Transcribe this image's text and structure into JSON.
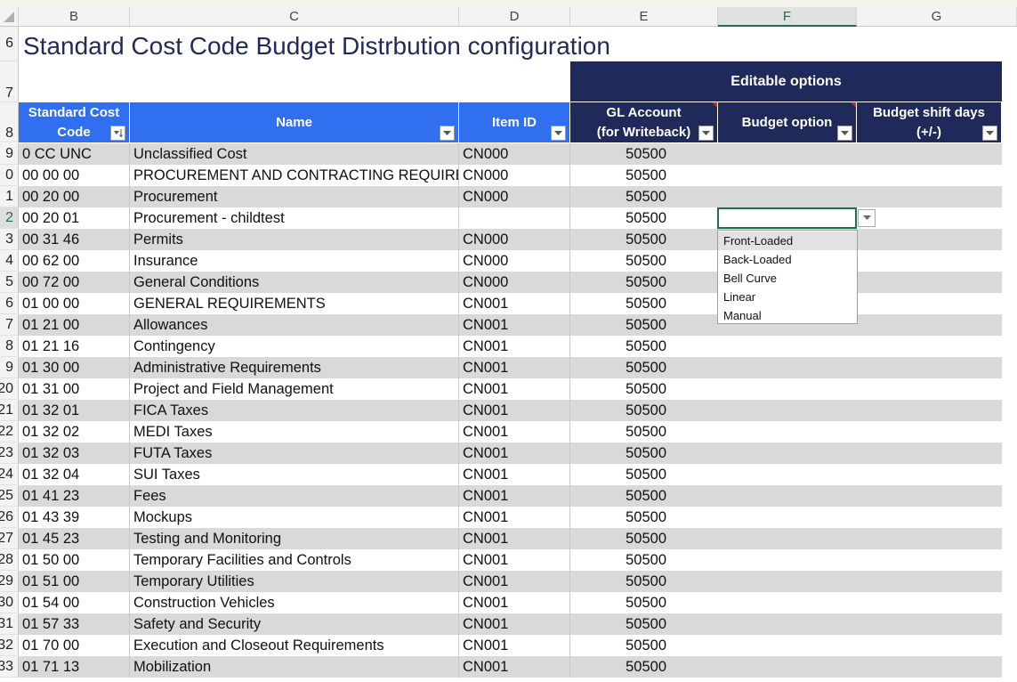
{
  "columns": [
    "B",
    "C",
    "D",
    "E",
    "F",
    "G"
  ],
  "title": "Standard Cost Code Budget Distrbution configuration",
  "editable_options": "Editable options",
  "headers": {
    "code": [
      "Standard Cost",
      "Code"
    ],
    "name": "Name",
    "item_id": "Item ID",
    "gl": [
      "GL Account",
      "(for Writeback)"
    ],
    "budget_option": "Budget option",
    "shift": [
      "Budget shift days",
      "(+/-)"
    ]
  },
  "header_row_numbers": [
    "6",
    "7",
    "8"
  ],
  "rows": [
    {
      "n": "9",
      "code": "0 CC UNC",
      "name": "Unclassified Cost",
      "item": "CN000",
      "gl": "50500"
    },
    {
      "n": "0",
      "code": "00 00 00",
      "name": "PROCUREMENT AND CONTRACTING REQUIRE",
      "item": "CN000",
      "gl": "50500"
    },
    {
      "n": "1",
      "code": "00 20 00",
      "name": "Procurement",
      "item": "CN000",
      "gl": "50500"
    },
    {
      "n": "2",
      "code": "00 20 01",
      "name": "Procurement - childtest",
      "item": "",
      "gl": "50500"
    },
    {
      "n": "3",
      "code": "00 31 46",
      "name": "Permits",
      "item": "CN000",
      "gl": "50500"
    },
    {
      "n": "4",
      "code": "00 62 00",
      "name": "Insurance",
      "item": "CN000",
      "gl": "50500"
    },
    {
      "n": "5",
      "code": "00 72 00",
      "name": "General Conditions",
      "item": "CN000",
      "gl": "50500"
    },
    {
      "n": "6",
      "code": "01 00 00",
      "name": "GENERAL REQUIREMENTS",
      "item": "CN001",
      "gl": "50500"
    },
    {
      "n": "7",
      "code": "01 21 00",
      "name": "Allowances",
      "item": "CN001",
      "gl": "50500"
    },
    {
      "n": "8",
      "code": "01 21 16",
      "name": "Contingency",
      "item": "CN001",
      "gl": "50500"
    },
    {
      "n": "9",
      "code": "01 30 00",
      "name": "Administrative Requirements",
      "item": "CN001",
      "gl": "50500"
    },
    {
      "n": "20",
      "code": "01 31 00",
      "name": "Project and Field Management",
      "item": "CN001",
      "gl": "50500"
    },
    {
      "n": "21",
      "code": "01 32 01",
      "name": "FICA Taxes",
      "item": "CN001",
      "gl": "50500"
    },
    {
      "n": "22",
      "code": "01 32 02",
      "name": "MEDI Taxes",
      "item": "CN001",
      "gl": "50500"
    },
    {
      "n": "23",
      "code": "01 32 03",
      "name": "FUTA Taxes",
      "item": "CN001",
      "gl": "50500"
    },
    {
      "n": "24",
      "code": "01 32 04",
      "name": "SUI Taxes",
      "item": "CN001",
      "gl": "50500"
    },
    {
      "n": "25",
      "code": "01 41 23",
      "name": "Fees",
      "item": "CN001",
      "gl": "50500"
    },
    {
      "n": "26",
      "code": "01 43 39",
      "name": "Mockups",
      "item": "CN001",
      "gl": "50500"
    },
    {
      "n": "27",
      "code": "01 45 23",
      "name": "Testing and Monitoring",
      "item": "CN001",
      "gl": "50500"
    },
    {
      "n": "28",
      "code": "01 50 00",
      "name": "Temporary Facilities and Controls",
      "item": "CN001",
      "gl": "50500"
    },
    {
      "n": "29",
      "code": "01 51 00",
      "name": "Temporary Utilities",
      "item": "CN001",
      "gl": "50500"
    },
    {
      "n": "30",
      "code": "01 54 00",
      "name": "Construction Vehicles",
      "item": "CN001",
      "gl": "50500"
    },
    {
      "n": "31",
      "code": "01 57 33",
      "name": "Safety and Security",
      "item": "CN001",
      "gl": "50500"
    },
    {
      "n": "32",
      "code": "01 70 00",
      "name": "Execution and Closeout Requirements",
      "item": "CN001",
      "gl": "50500"
    },
    {
      "n": "33",
      "code": "01 71 13",
      "name": "Mobilization",
      "item": "CN001",
      "gl": "50500"
    }
  ],
  "dropdown": {
    "options": [
      "Front-Loaded",
      "Back-Loaded",
      "Bell Curve",
      "Linear",
      "Manual"
    ],
    "highlighted_index": 0
  },
  "colors": {
    "navy": "#1f2a5a",
    "blue": "#2f6ff0",
    "shade": "#d9d9d9",
    "selection": "#1e7145"
  }
}
